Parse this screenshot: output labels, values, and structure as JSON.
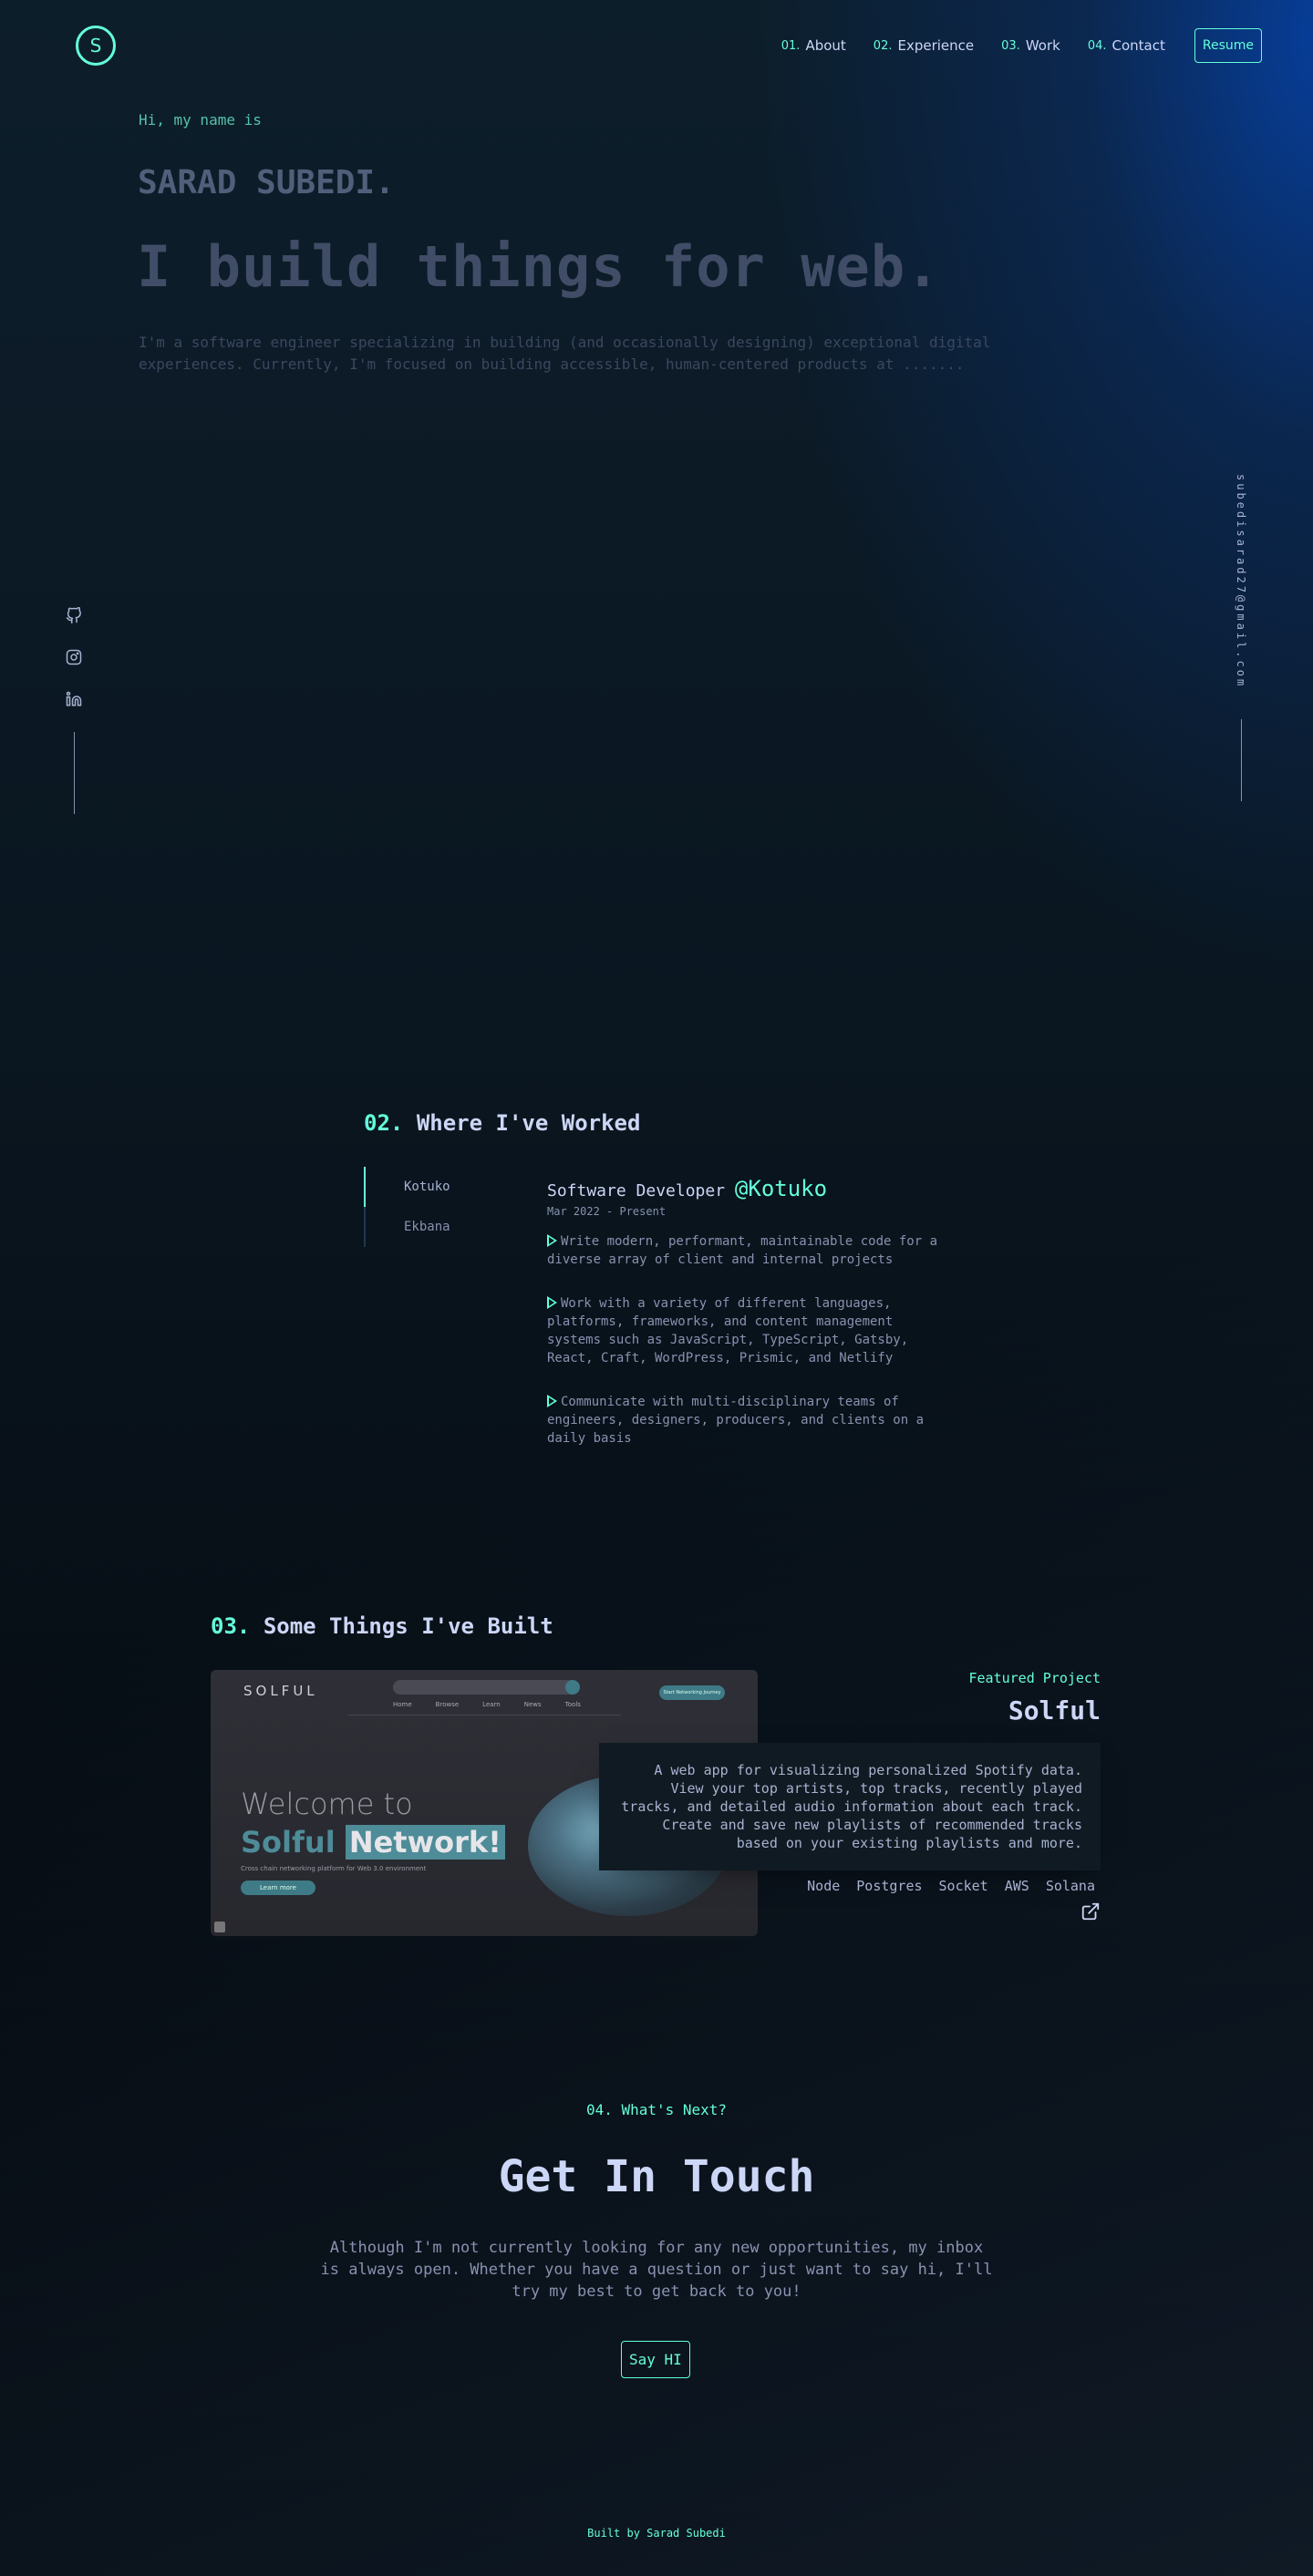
{
  "logo": {
    "letter": "S"
  },
  "nav": {
    "items": [
      {
        "num": "01.",
        "label": "About"
      },
      {
        "num": "02.",
        "label": "Experience"
      },
      {
        "num": "03.",
        "label": "Work"
      },
      {
        "num": "04.",
        "label": "Contact"
      }
    ],
    "resume": "Resume"
  },
  "hero": {
    "greeting": "Hi, my name is",
    "name": "SARAD SUBEDI.",
    "tagline": "I build things for web.",
    "description": "I'm a software engineer specializing in building (and occasionally designing) exceptional digital experiences. Currently, I'm focused on building accessible, human-centered products at ......."
  },
  "social": {
    "icons": [
      "github-icon",
      "instagram-icon",
      "linkedin-icon"
    ]
  },
  "email": "subedisarad27@gmail.com",
  "experience": {
    "num": "02.",
    "title": "Where I've Worked",
    "tabs": [
      "Kotuko",
      "Ekbana"
    ],
    "active_tab": "Kotuko",
    "job": {
      "title": "Software Developer",
      "company": "@Kotuko",
      "range": "Mar 2022 - Present",
      "points": [
        "Write modern, performant, maintainable code for a diverse array of client and internal projects",
        "Work with a variety of different languages, platforms, frameworks, and content management systems such as JavaScript, TypeScript, Gatsby, React, Craft, WordPress, Prismic, and Netlify",
        "Communicate with multi-disciplinary teams of engineers, designers, producers, and clients on a daily basis"
      ]
    }
  },
  "projects": {
    "num": "03.",
    "title": "Some Things I've Built",
    "featured_label": "Featured Project",
    "name": "Solful",
    "description": "A web app for visualizing personalized Spotify data. View your top artists, top tracks, recently played tracks, and detailed audio information about each track. Create and save new playlists of recommended tracks based on your existing playlists and more.",
    "tech": [
      "Node",
      "Postgres",
      "Socket",
      "AWS",
      "Solana"
    ],
    "screenshot": {
      "brand": "SOLFUL",
      "nav_links": [
        "Home",
        "Browse",
        "Learn",
        "News",
        "Tools"
      ],
      "heading_line1": "Welcome to",
      "heading_word1": "Solful",
      "heading_word2": "Network!",
      "subtitle": "Cross chain networking platform for Web 3.0 environment",
      "cta": "Learn more",
      "top_button": "Start Networking Journey"
    }
  },
  "contact": {
    "overline": "04. What's Next?",
    "title": "Get In Touch",
    "text": "Although I'm not currently looking for any new opportunities, my inbox is always open. Whether you have a question or just want to say hi, I'll try my best to get back to you!",
    "button": "Say HI"
  },
  "footer": "Built by Sarad Subedi",
  "colors": {
    "accent": "#64ffda",
    "text": "#ccd6f6",
    "muted": "#8892b0"
  }
}
